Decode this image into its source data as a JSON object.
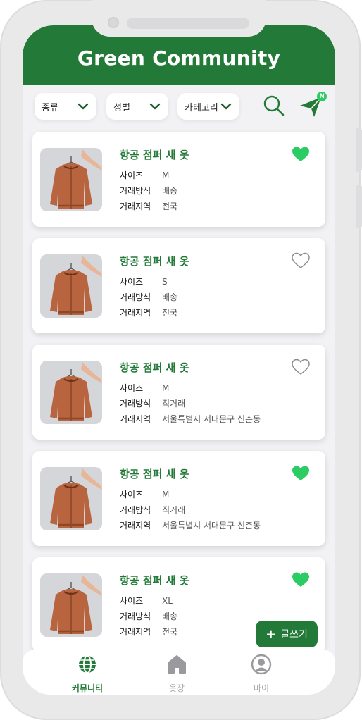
{
  "app": {
    "title": "Green Community"
  },
  "filters": [
    {
      "label": "종류"
    },
    {
      "label": "성별"
    },
    {
      "label": "카테고리"
    }
  ],
  "notification_badge": "N",
  "field_labels": {
    "size": "사이즈",
    "method": "거래방식",
    "region": "거래지역"
  },
  "colors": {
    "brand": "#237a38",
    "accent": "#2bcc63",
    "garment": "#b8643e"
  },
  "posts": [
    {
      "title": "항공 점퍼 새 옷",
      "size": "M",
      "method": "배송",
      "region": "전국",
      "liked": true
    },
    {
      "title": "항공 점퍼 새 옷",
      "size": "S",
      "method": "배송",
      "region": "전국",
      "liked": false
    },
    {
      "title": "항공 점퍼 새 옷",
      "size": "M",
      "method": "직거래",
      "region": "서울특별시 서대문구 신촌동",
      "liked": false
    },
    {
      "title": "항공 점퍼 새 옷",
      "size": "M",
      "method": "직거래",
      "region": "서울특별시 서대문구 신촌동",
      "liked": true
    },
    {
      "title": "항공 점퍼 새 옷",
      "size": "XL",
      "method": "배송",
      "region": "전국",
      "liked": true
    }
  ],
  "write_button": {
    "plus": "+",
    "label": "글쓰기"
  },
  "nav": [
    {
      "label": "커뮤니티",
      "icon": "globe-icon",
      "active": true
    },
    {
      "label": "옷장",
      "icon": "home-icon",
      "active": false
    },
    {
      "label": "마이",
      "icon": "profile-icon",
      "active": false
    }
  ]
}
